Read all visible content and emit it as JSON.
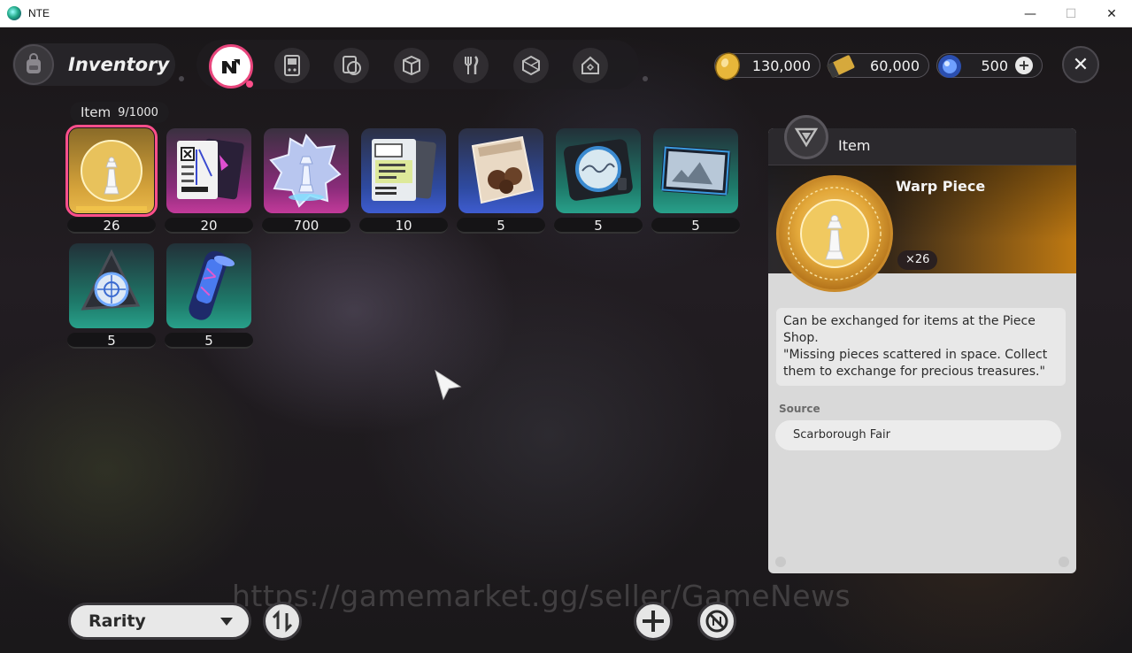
{
  "window": {
    "title": "NTE",
    "minimize": "—",
    "maximize": "☐",
    "close": "✕"
  },
  "header": {
    "title": "Inventory",
    "tabs": [
      {
        "name": "items",
        "active": true
      },
      {
        "name": "gadgets",
        "active": false
      },
      {
        "name": "cards",
        "active": false
      },
      {
        "name": "boxes",
        "active": false
      },
      {
        "name": "food",
        "active": false
      },
      {
        "name": "materials",
        "active": false
      },
      {
        "name": "housing",
        "active": false
      }
    ]
  },
  "currency": {
    "gold": "130,000",
    "ticket": "60,000",
    "gem": "500"
  },
  "inventory": {
    "label": "Item",
    "count": "9/1000",
    "items": [
      {
        "qty": "26",
        "rarity": "gold",
        "art": "warp-piece"
      },
      {
        "qty": "20",
        "rarity": "pink",
        "art": "cards"
      },
      {
        "qty": "700",
        "rarity": "pink",
        "art": "crystal"
      },
      {
        "qty": "10",
        "rarity": "blue",
        "art": "cards-blue"
      },
      {
        "qty": "5",
        "rarity": "blue",
        "art": "snack-bag"
      },
      {
        "qty": "5",
        "rarity": "teal",
        "art": "device"
      },
      {
        "qty": "5",
        "rarity": "teal",
        "art": "photo"
      },
      {
        "qty": "5",
        "rarity": "teal",
        "art": "shard"
      },
      {
        "qty": "5",
        "rarity": "teal",
        "art": "cylinder"
      }
    ]
  },
  "detail": {
    "category": "Item",
    "name": "Warp Piece",
    "qty": "×26",
    "description_1": "Can be exchanged for items at the Piece Shop.",
    "description_2": "\"Missing pieces scattered in space. Collect them to exchange for precious treasures.\"",
    "source_label": "Source",
    "source": "Scarborough Fair"
  },
  "footer": {
    "sort_label": "Rarity"
  },
  "watermark": "https://gamemarket.gg/seller/GameNews",
  "colors": {
    "accent": "#ff4f8b",
    "gold": "#e3a83a",
    "panel": "#d9d9d9"
  }
}
